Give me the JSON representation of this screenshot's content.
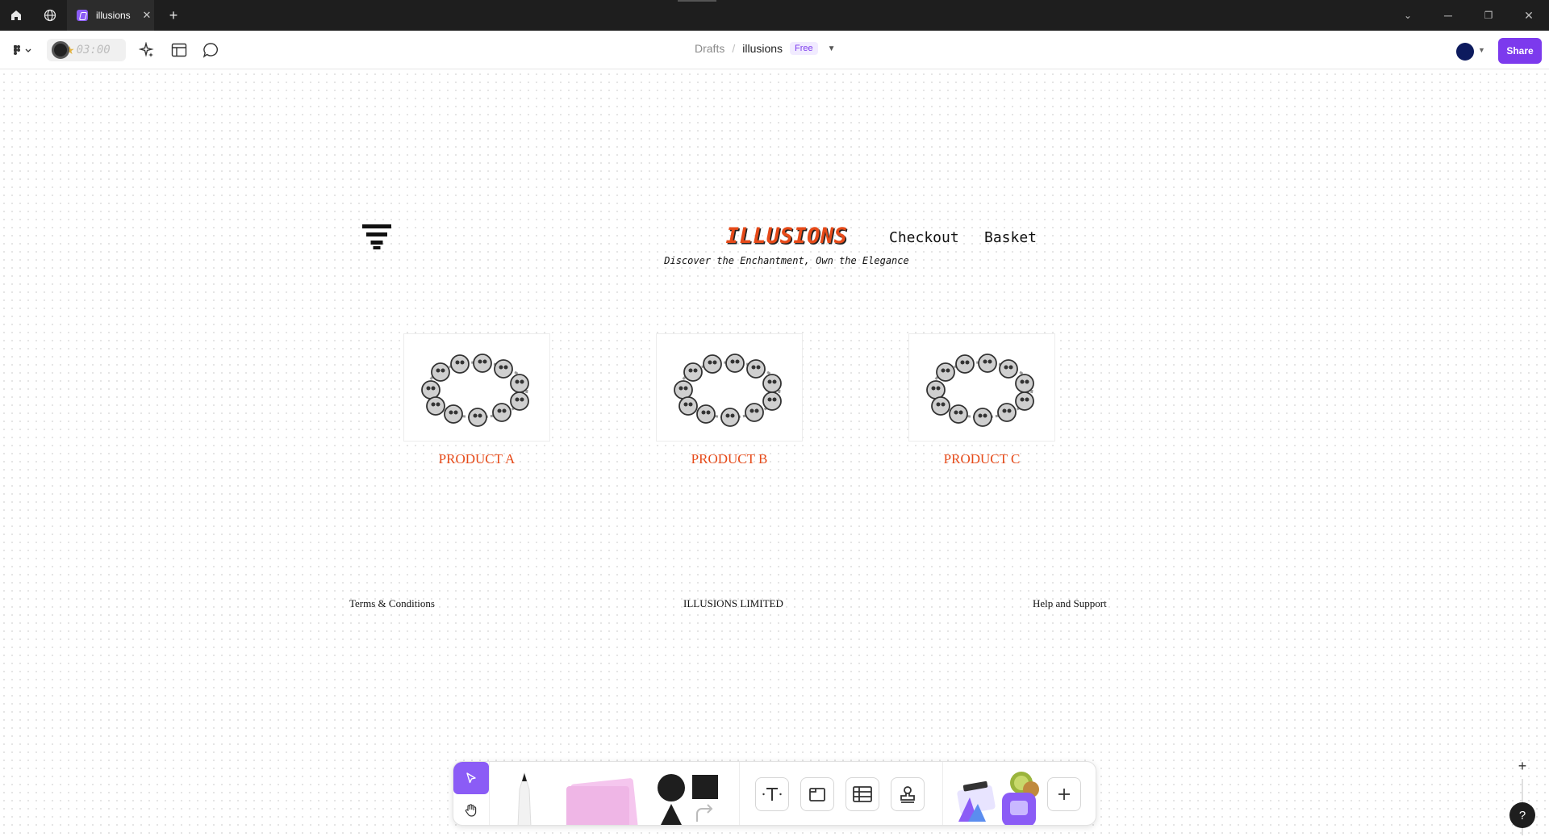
{
  "titlebar": {
    "tab_title": "illusions",
    "new_tab": "+",
    "close_tab": "✕"
  },
  "toolbar": {
    "timer": "03:00",
    "breadcrumb_root": "Drafts",
    "breadcrumb_sep": "/",
    "file_name": "illusions",
    "plan_badge": "Free",
    "share_label": "Share",
    "avatar_color": "#0d1b5e",
    "accent": "#7c3aed"
  },
  "canvas": {
    "brand": "ILLUSIONS",
    "tagline": "Discover the Enchantment, Own the Elegance",
    "nav": [
      "Checkout",
      "Basket"
    ],
    "products": [
      {
        "name": "PRODUCT A"
      },
      {
        "name": "PRODUCT B"
      },
      {
        "name": "PRODUCT C"
      }
    ],
    "footer": {
      "left": "Terms & Conditions",
      "center": "ILLUSIONS LIMITED",
      "right": "Help and Support"
    },
    "brand_color": "#e64a19"
  },
  "bottom_toolbar": {
    "tools": [
      "move-tool",
      "hand-tool",
      "pen-tool",
      "sticky-note",
      "shapes",
      "text-tool",
      "section-tool",
      "table-tool",
      "stamp-tool",
      "widgets",
      "more"
    ]
  },
  "zoom": {
    "zoom_in": "+",
    "zoom_out": "−",
    "help": "?"
  }
}
